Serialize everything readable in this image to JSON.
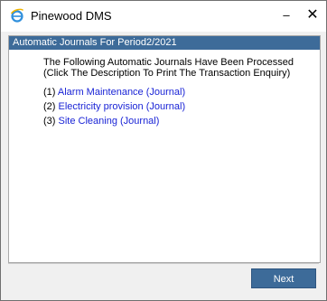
{
  "window": {
    "title": "Pinewood DMS",
    "minimize_glyph": "–",
    "close_glyph": "✕",
    "app_icon": "ie-browser-icon"
  },
  "panel": {
    "header": "Automatic Journals For Period2/2021",
    "intro_line1": "The Following Automatic Journals Have Been Processed",
    "intro_line2": "(Click The Description To Print The Transaction Enquiry)"
  },
  "journals": [
    {
      "number": "(1)",
      "label": "Alarm Maintenance (Journal)"
    },
    {
      "number": "(2)",
      "label": "Electricity provision (Journal)"
    },
    {
      "number": "(3)",
      "label": "Site Cleaning (Journal)"
    }
  ],
  "footer": {
    "next_label": "Next"
  },
  "colors": {
    "header_bg": "#3d6b99",
    "link": "#1a24d6",
    "button_bg": "#3d6b99"
  }
}
